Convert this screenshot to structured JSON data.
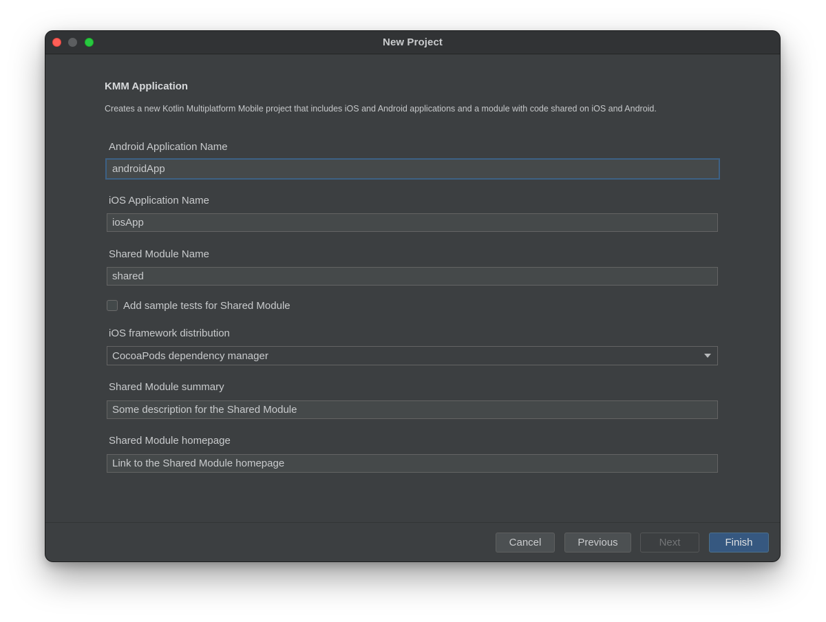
{
  "window": {
    "title": "New Project"
  },
  "form": {
    "heading": "KMM Application",
    "description": "Creates a new Kotlin Multiplatform Mobile project that includes iOS and Android applications and a module with code shared on iOS and Android.",
    "android_app_name": {
      "label": "Android Application Name",
      "value": "androidApp"
    },
    "ios_app_name": {
      "label": "iOS Application Name",
      "value": "iosApp"
    },
    "shared_module_name": {
      "label": "Shared Module Name",
      "value": "shared"
    },
    "sample_tests": {
      "label": "Add sample tests for Shared Module",
      "checked": false
    },
    "ios_framework_distribution": {
      "label": "iOS framework distribution",
      "selected": "CocoaPods dependency manager"
    },
    "shared_module_summary": {
      "label": "Shared Module summary",
      "value": "Some description for the Shared Module"
    },
    "shared_module_homepage": {
      "label": "Shared Module homepage",
      "value": "Link to the Shared Module homepage"
    }
  },
  "footer": {
    "cancel_label": "Cancel",
    "previous_label": "Previous",
    "next_label": "Next",
    "finish_label": "Finish"
  },
  "colors": {
    "window_bg": "#3c3f41",
    "field_bg": "#45494a",
    "focus_border": "#3d6185",
    "primary_button": "#365880",
    "close_light": "#ff5f57",
    "maximize_light": "#28c840"
  }
}
